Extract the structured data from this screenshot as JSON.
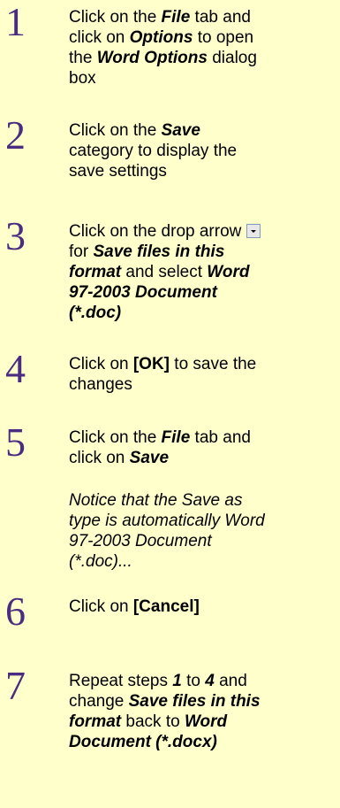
{
  "steps": [
    {
      "number": "1",
      "lines": [
        [
          "Click on the ",
          "File",
          " tab and"
        ],
        [
          "click on ",
          "Options",
          " to open"
        ],
        [
          "the ",
          "Word Options",
          " dialog"
        ],
        [
          "box"
        ]
      ]
    },
    {
      "number": "2",
      "lines": [
        [
          "Click on the ",
          "Save"
        ],
        [
          "category to display the"
        ],
        [
          "save settings"
        ]
      ]
    },
    {
      "number": "3",
      "line1_text": "Click on the drop arrow",
      "line2": [
        "for ",
        "Save files in this"
      ],
      "line3": [
        "format",
        " and select ",
        "Word"
      ],
      "line4": "97-2003 Document",
      "line5": "(*.doc)"
    },
    {
      "number": "4",
      "line1": [
        "Click on ",
        "[OK]",
        " to save the"
      ],
      "line2": "changes"
    },
    {
      "number": "5",
      "line1": [
        "Click on the ",
        "File",
        " tab and"
      ],
      "line2": [
        "click on ",
        "Save"
      ]
    },
    {
      "number": "6",
      "line1": [
        "Click on ",
        "[Cancel]"
      ]
    },
    {
      "number": "7",
      "line1": [
        "Repeat steps ",
        "1",
        " to ",
        "4",
        " and"
      ],
      "line2": [
        "change ",
        "Save files in this"
      ],
      "line3": [
        "format",
        " back to ",
        "Word"
      ],
      "line4": "Document (*.docx)"
    }
  ],
  "note_lines": [
    "Notice that the Save as",
    "type is automatically Word",
    "97-2003 Document",
    "(*.doc)..."
  ],
  "icons": {
    "dropdown": "dropdown-arrow-icon"
  },
  "colors": {
    "background": "#FFFFCC",
    "step_number": "#4A2D80"
  }
}
